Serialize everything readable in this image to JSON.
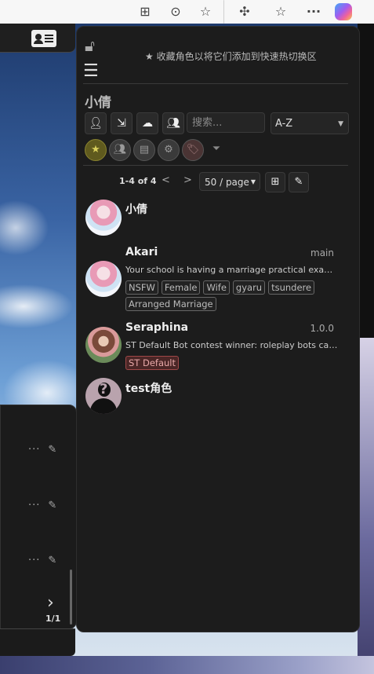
{
  "browser": {
    "icons": [
      "app-available-icon",
      "more-tools-icon",
      "favorite-star-icon",
      "extensions-icon",
      "favorites-list-icon",
      "menu-dots-icon",
      "copilot-icon"
    ]
  },
  "bg_left": {
    "row_dots": "···",
    "next_glyph": "›",
    "page_indicator": "1/1"
  },
  "panel": {
    "favorites_hint": "★ 收藏角色以将它们添加到快速热切换区",
    "title": "小倩",
    "search_placeholder": "搜索...",
    "sort_selected": "A-Z",
    "pagination": {
      "count": "1-4 of 4",
      "prev": "<",
      "next": ">",
      "page_size": "50 / page"
    },
    "characters": [
      {
        "name": "小倩",
        "version": "",
        "description": "",
        "tags": []
      },
      {
        "name": "Akari",
        "version": "main",
        "description": "Your school is having a marriage practical exam, ...",
        "tags": [
          "NSFW",
          "Female",
          "Wife",
          "gyaru",
          "tsundere",
          "Arranged Marriage"
        ]
      },
      {
        "name": "Seraphina",
        "version": "1.0.0",
        "description": "ST Default Bot contest winner: roleplay bots cate...",
        "tags": [
          "ST Default"
        ]
      },
      {
        "name": "test角色",
        "version": "",
        "description": "",
        "tags": []
      }
    ]
  },
  "colors": {
    "panel_bg": "#1c1c1c",
    "favorite_filter": "#5f5a1e",
    "st_default_tag": "#4a2626"
  }
}
